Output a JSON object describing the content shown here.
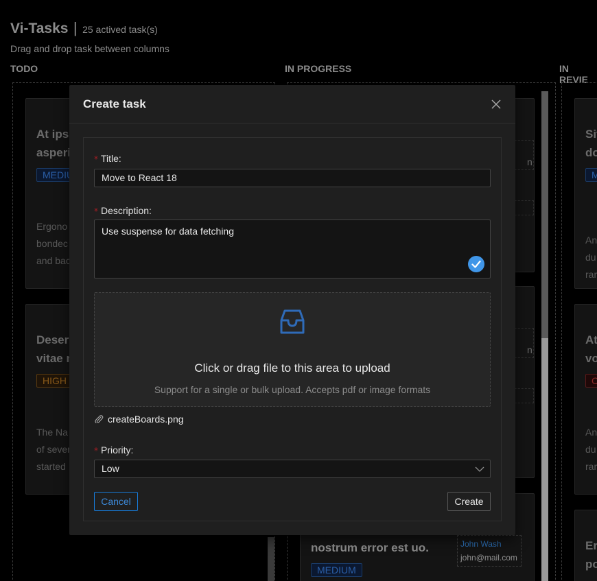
{
  "app": {
    "title": "Vi-Tasks",
    "separator": "|",
    "active_count": "25 actived task(s)",
    "subtitle": "Drag and drop task between columns"
  },
  "columns": [
    {
      "title": "TODO"
    },
    {
      "title": "IN PROGRESS"
    },
    {
      "title": "IN REVIE"
    }
  ],
  "cards": {
    "todo_1": {
      "title_l1": "At ipsu",
      "title_l2": "asperio",
      "tag": "MEDIU",
      "desc_l1": "Ergono",
      "desc_l2": "bondec",
      "desc_l3": "and bac"
    },
    "todo_2": {
      "title_l1": "Deseru",
      "title_l2": "vitae n",
      "tag": "HIGH",
      "desc_l1": "The Na",
      "desc_l2": "of sever",
      "desc_l3": "started"
    },
    "prog_1": {
      "assignee_frag": "n"
    },
    "prog_2": {
      "assignee_frag": "n"
    },
    "prog_3": {
      "title": "nostrum error est uo.",
      "tag": "MEDIUM",
      "assignee_name": "John Wash",
      "assignee_email": "john@mail.com"
    },
    "rev_1": {
      "title_l1": "Sit",
      "title_l2": "do",
      "tag": "M",
      "desc_l1": "An",
      "desc_l2": "du",
      "desc_l3": "rar"
    },
    "rev_2": {
      "title_l1": "At",
      "title_l2": "vo",
      "tag": "C",
      "desc_l1": "An",
      "desc_l2": "du",
      "desc_l3": "rar"
    },
    "rev_3": {
      "title_l1": "Err",
      "title_l2": "po"
    }
  },
  "modal": {
    "title": "Create task",
    "fields": {
      "title_label": "Title:",
      "title_value": "Move to React 18",
      "description_label": "Description:",
      "description_value": "Use suspense for data fetching",
      "priority_label": "Priority:",
      "priority_value": "Low"
    },
    "required_mark": "*",
    "upload": {
      "text": "Click or drag file to this area to upload",
      "hint": "Support for a single or bulk upload. Accepts pdf or image formats",
      "files": [
        "createBoards.png"
      ]
    },
    "buttons": {
      "cancel": "Cancel",
      "create": "Create"
    }
  },
  "colors": {
    "accent": "#177ddc",
    "upload_icon": "#2f6bb8",
    "check_icon": "#4096e8",
    "required": "#a61d24"
  },
  "icons": {
    "close": "close-icon",
    "upload": "inbox-icon",
    "attachment": "paperclip-icon",
    "select": "chevron-down-icon",
    "valid": "check-circle-icon"
  }
}
